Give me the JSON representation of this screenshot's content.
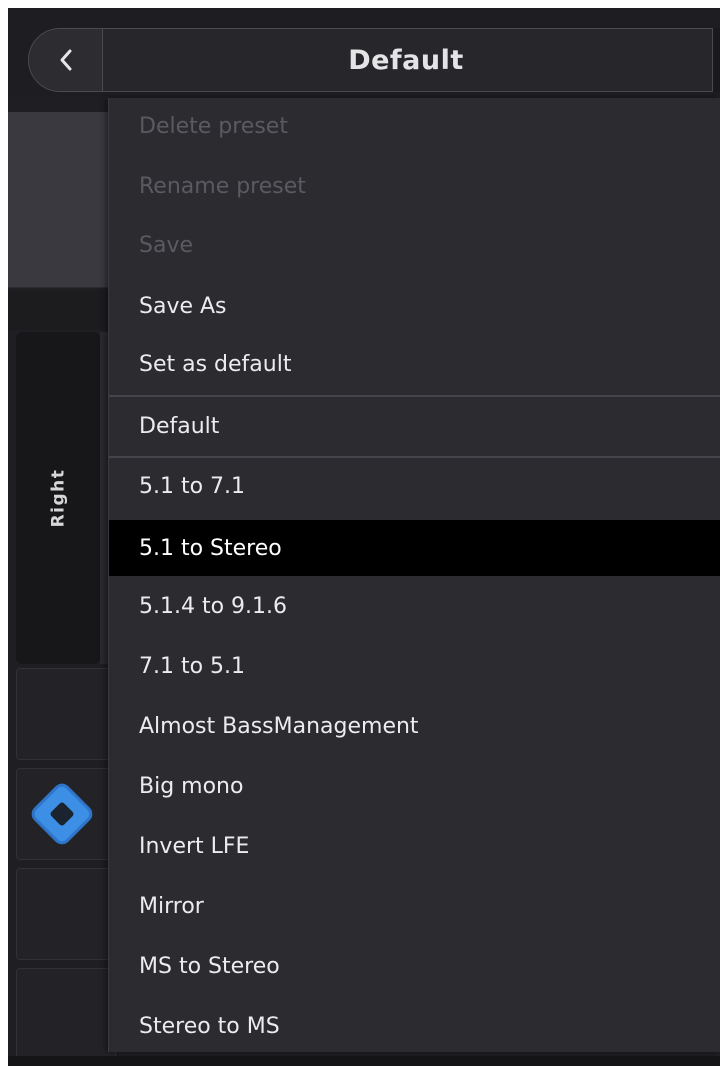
{
  "header": {
    "back_icon": "chevron-left-icon",
    "title": "Default"
  },
  "channel_tab": {
    "label": "Right"
  },
  "knob": {
    "icon": "diamond-knob-icon",
    "color": "#3d8fe6"
  },
  "menu": {
    "actions": [
      {
        "label": "Delete preset",
        "enabled": false
      },
      {
        "label": "Rename preset",
        "enabled": false
      },
      {
        "label": "Save",
        "enabled": false
      },
      {
        "label": "Save As",
        "enabled": true
      },
      {
        "label": "Set as default",
        "enabled": true
      }
    ],
    "default_preset": "Default",
    "presets": [
      {
        "label": "5.1 to 7.1",
        "selected": false
      },
      {
        "label": "5.1 to Stereo",
        "selected": true
      },
      {
        "label": "5.1.4 to 9.1.6",
        "selected": false
      },
      {
        "label": "7.1 to 5.1",
        "selected": false
      },
      {
        "label": "Almost BassManagement",
        "selected": false
      },
      {
        "label": "Big mono",
        "selected": false
      },
      {
        "label": "Invert LFE",
        "selected": false
      },
      {
        "label": "Mirror",
        "selected": false
      },
      {
        "label": "MS to Stereo",
        "selected": false
      },
      {
        "label": "Stereo to MS",
        "selected": false
      }
    ]
  }
}
